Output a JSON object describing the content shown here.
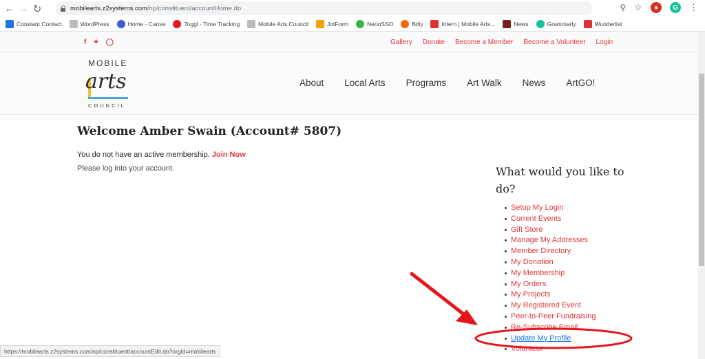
{
  "browser": {
    "url_host": "mobilearts.z2systems.com",
    "url_path": "/np/constituent/accountHome.do",
    "bookmarks": [
      "Constant Contact",
      "WordPress",
      "Home - Canva",
      "Toggl - Time Tracking",
      "Mobile Arts Council",
      "JotForm",
      "NeonSSO",
      "Bitly",
      "Intern | Mobile Arts...",
      "News",
      "Grammarly",
      "Wunderlist"
    ],
    "status_url": "https://mobilearts.z2systems.com/np/constituent/accountEdit.do?orgId=mobilearts"
  },
  "topbar": {
    "links": [
      "Gallery",
      "Donate",
      "Become a Member",
      "Become a Volunteer",
      "Login"
    ]
  },
  "logo": {
    "top": "MOBILE",
    "middle": "arts",
    "bottom": "COUNCIL"
  },
  "nav": [
    "About",
    "Local Arts",
    "Programs",
    "Art Walk",
    "News",
    "ArtGO!"
  ],
  "main": {
    "welcome": "Welcome Amber Swain (Account# 5807)",
    "membership_text": "You do not have an active membership.",
    "join_link": "Join Now",
    "login_text": "Please log into your account."
  },
  "sidebar": {
    "title": "What would you like to do?",
    "links": [
      "Setup My Login",
      "Current Events",
      "Gift Store",
      "Manage My Addresses",
      "Member Directory",
      "My Donation",
      "My Membership",
      "My Orders",
      "My Projects",
      "My Registered Event",
      "Peer-to-Peer Fundraising",
      "Re-Subscribe Email",
      "Update My Profile",
      "Volunteer"
    ]
  },
  "colors": {
    "accent": "#e0383b",
    "link_active": "#1a73e8",
    "annotation": "#e8141b"
  }
}
